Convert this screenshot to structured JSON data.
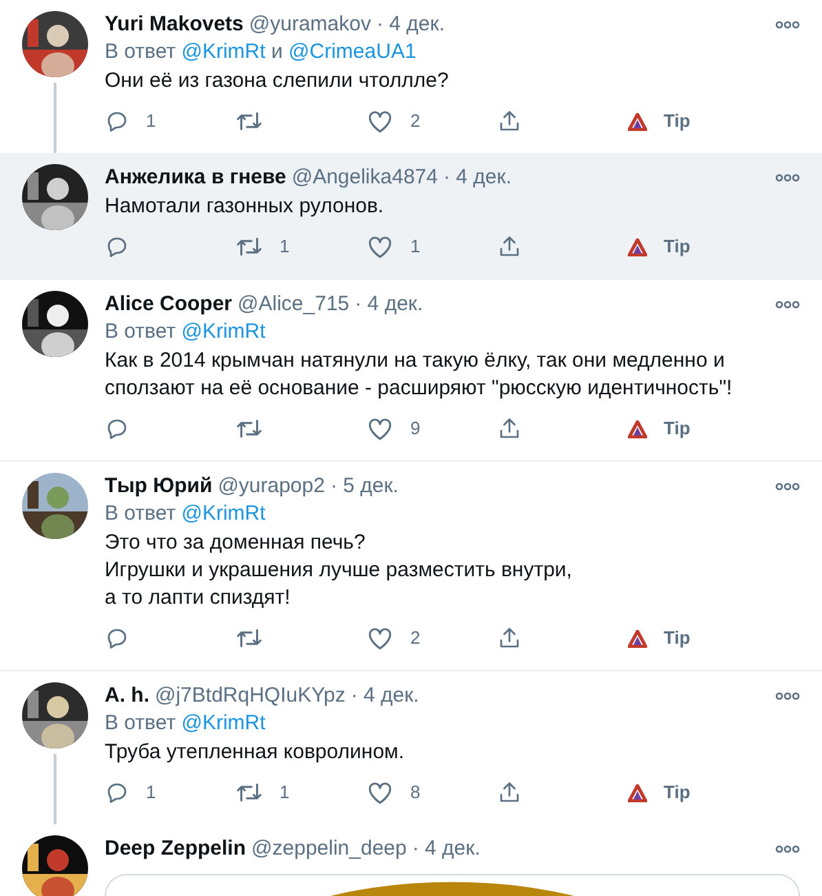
{
  "tweets": [
    {
      "name": "Yuri Makovets",
      "handle": "@yuramakov",
      "date": "· 4 дек.",
      "highlighted": false,
      "thread_continues": true,
      "reply_line": [
        {
          "text": "В ответ",
          "link": false
        },
        {
          "text": "@KrimRt",
          "link": true
        },
        {
          "text": "и",
          "link": false
        },
        {
          "text": "@CrimeaUA1",
          "link": true
        }
      ],
      "text": [
        "Они её из газона слепили чтоллле?"
      ],
      "replies": "1",
      "likes": "2",
      "tip": "Tip",
      "avatar": {
        "kind": "picture"
      }
    },
    {
      "name": "Анжелика в гневе",
      "handle": "@Angelika4874",
      "date": "· 4 дек.",
      "highlighted": true,
      "thread_continues": false,
      "text": [
        "Намотали газонных рулонов."
      ],
      "retweets": "1",
      "likes": "1",
      "tip": "Tip",
      "avatar": {
        "kind": "picture"
      }
    },
    {
      "name": "Alice Cooper",
      "handle": "@Alice_715",
      "date": "· 4 дек.",
      "highlighted": false,
      "thread_continues": false,
      "reply_line": [
        {
          "text": "В ответ",
          "link": false
        },
        {
          "text": "@KrimRt",
          "link": true
        }
      ],
      "text": [
        "Как в 2014 крымчан натянули на такую ёлку, так они медленно и сползают на её основание - расширяют \"рюсскую идентичность\"!"
      ],
      "likes": "9",
      "tip": "Tip",
      "avatar": {
        "kind": "picture"
      }
    },
    {
      "name": "Тыр Юрий",
      "handle": "@yurapop2",
      "date": "· 5 дек.",
      "highlighted": false,
      "thread_continues": false,
      "reply_line": [
        {
          "text": "В ответ",
          "link": false
        },
        {
          "text": "@KrimRt",
          "link": true
        }
      ],
      "text": [
        "Это что за доменная печь?",
        "Игрушки и украшения лучше разместить внутри,",
        "а то лапти спиздят!"
      ],
      "likes": "2",
      "tip": "Tip",
      "avatar": {
        "kind": "picture"
      }
    },
    {
      "name": "A. h.",
      "handle": "@j7BtdRqHQIuKYpz",
      "date": "· 4 дек.",
      "highlighted": false,
      "thread_continues": true,
      "reply_line": [
        {
          "text": "В ответ",
          "link": false
        },
        {
          "text": "@KrimRt",
          "link": true
        }
      ],
      "text": [
        "Труба утепленная ковролином."
      ],
      "replies": "1",
      "retweets": "1",
      "likes": "8",
      "tip": "Tip",
      "avatar": {
        "kind": "picture"
      }
    },
    {
      "name": "Deep Zeppelin",
      "handle": "@zeppelin_deep",
      "date": "· 4 дек.",
      "highlighted": false,
      "thread_continues": false,
      "avatar": {
        "kind": "picture"
      },
      "media": {
        "kind": "picture"
      }
    }
  ]
}
